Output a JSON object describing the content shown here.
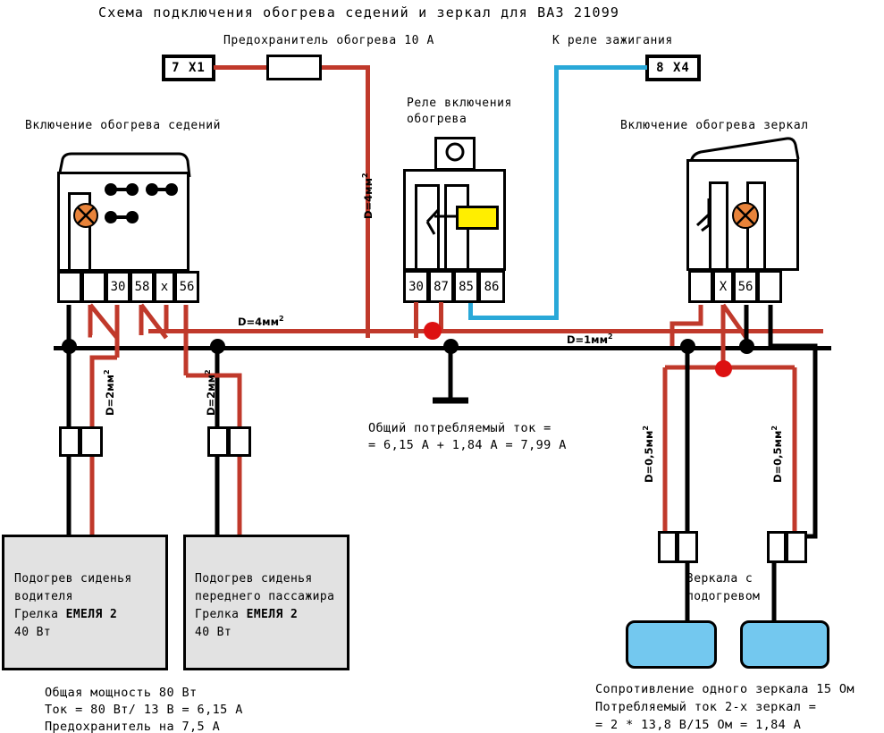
{
  "title": "Схема подключения обогрева седений и зеркал для ВАЗ 21099",
  "labels": {
    "fuse_heating": "Предохранитель обогрева 10 А",
    "to_ignition_relay": "К реле зажигания",
    "seat_heat_switch": "Включение обогрева седений",
    "relay_line1": "Реле включения",
    "relay_line2": "обогрева",
    "mirror_heat_switch": "Включение обогрева зеркал",
    "mirrors_line1": "Зеркала с",
    "mirrors_line2": "подогревом"
  },
  "terminals": {
    "x1": "7 X1",
    "x4": "8 X4"
  },
  "left_switch_pins": [
    "",
    "",
    "30",
    "58",
    "x",
    "56"
  ],
  "relay_pins": [
    "30",
    "87",
    "85",
    "86"
  ],
  "right_switch_pins": [
    "",
    "X",
    "56",
    ""
  ],
  "gauges": {
    "fuse_drop": "D=4мм",
    "main_red": "D=4мм",
    "main_black": "D=1мм",
    "seat_left": "D=2мм",
    "seat_right": "D=2мм",
    "mirror_left": "D=0,5мм",
    "mirror_right": "D=0,5мм",
    "sup": "2"
  },
  "seat_driver": {
    "line1": "Подогрев сиденья",
    "line2": "водителя",
    "line3_prefix": "Грелка ",
    "line3_bold": "ЕМЕЛЯ 2",
    "line4": "40 Вт"
  },
  "seat_passenger": {
    "line1": "Подогрев сиденья",
    "line2": "переднего пассажира",
    "line3_prefix": "Грелка ",
    "line3_bold": "ЕМЕЛЯ 2",
    "line4": "40 Вт"
  },
  "notes": {
    "total_current_line1": "Общий потребляемый ток =",
    "total_current_line2": "= 6,15 А + 1,84 А = 7,99 А",
    "seats_line1": "Общая мощность 80 Вт",
    "seats_line2": "Ток = 80 Вт/ 13 В = 6,15 А",
    "seats_line3": "Предохранитель на 7,5 А",
    "mirrors_line1": "Сопротивление одного зеркала 15 Ом",
    "mirrors_line2": "Потребляемый ток 2-х зеркал =",
    "mirrors_line3": "= 2 * 13,8 В/15 Ом = 1,84 А"
  },
  "colors": {
    "red_wire": "#c0392b",
    "black_wire": "#000000",
    "cyan_wire": "#29a8d8",
    "lamp": "#e8833a",
    "relay_coil": "#ffee00",
    "mirror_fill": "#73c8ef",
    "seat_fill": "#e2e2e2",
    "junction_red": "#dd1111"
  }
}
